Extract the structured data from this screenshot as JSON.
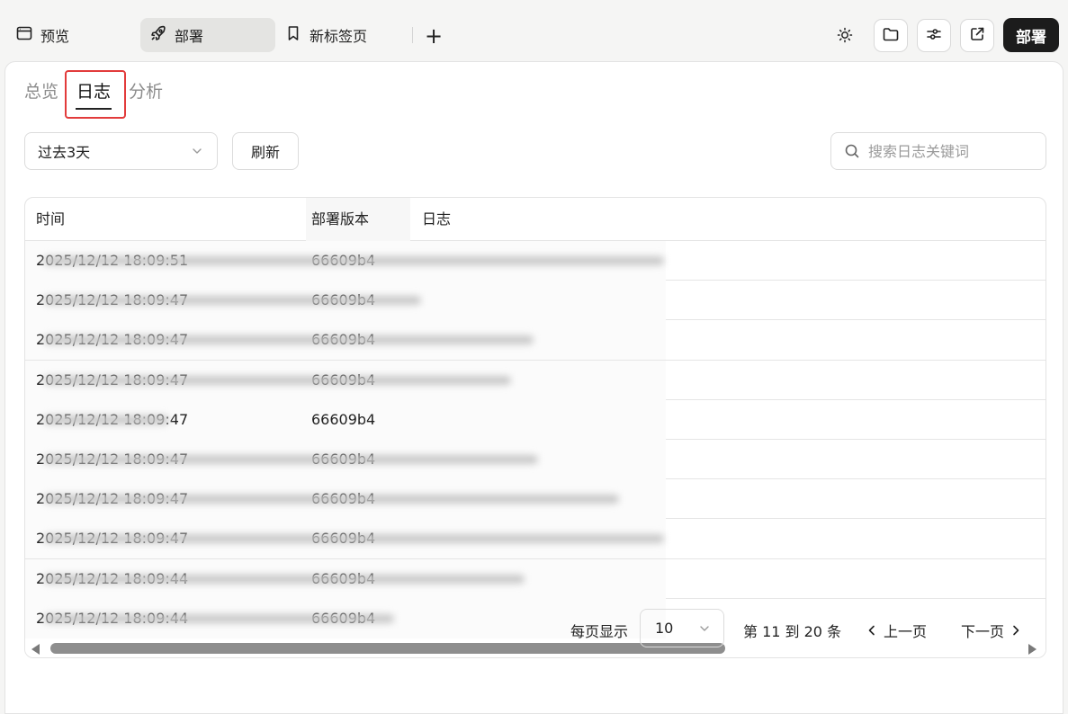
{
  "tabs": [
    {
      "label": "预览",
      "icon": "browser-window-icon"
    },
    {
      "label": "部署",
      "icon": "rocket-icon",
      "active": true
    },
    {
      "label": "新标签页",
      "icon": "bookmark-icon"
    }
  ],
  "add_tab": "+",
  "toolbar": {
    "icons": [
      "sun-icon",
      "folder-icon",
      "sliders-icon",
      "external-link-icon"
    ],
    "deploy_label": "部署"
  },
  "subtabs": [
    {
      "label": "总览"
    },
    {
      "label": "日志",
      "active": true
    },
    {
      "label": "分析"
    }
  ],
  "filters": {
    "range_value": "过去3天",
    "refresh_label": "刷新",
    "search_placeholder": "搜索日志关键词"
  },
  "table": {
    "columns": [
      "时间",
      "部署版本",
      "日志"
    ],
    "rows": [
      {
        "time": "2025/12/12 18:09:51",
        "version": "66609b4"
      },
      {
        "time": "2025/12/12 18:09:47",
        "version": "66609b4"
      },
      {
        "time": "2025/12/12 18:09:47",
        "version": "66609b4"
      },
      {
        "time": "2025/12/12 18:09:47",
        "version": "66609b4"
      },
      {
        "time": "2025/12/12 18:09:47",
        "version": "66609b4"
      },
      {
        "time": "2025/12/12 18:09:47",
        "version": "66609b4"
      },
      {
        "time": "2025/12/12 18:09:47",
        "version": "66609b4"
      },
      {
        "time": "2025/12/12 18:09:47",
        "version": "66609b4"
      },
      {
        "time": "2025/12/12 18:09:44",
        "version": "66609b4"
      },
      {
        "time": "2025/12/12 18:09:44",
        "version": "66609b4"
      }
    ]
  },
  "pagination": {
    "per_page_label": "每页显示",
    "per_page_value": "10",
    "range_label": "第 11 到 20 条",
    "prev_label": "上一页",
    "next_label": "下一页"
  },
  "colors": {
    "highlight": "#e23b3b",
    "primary_button": "#1c1c1c"
  }
}
